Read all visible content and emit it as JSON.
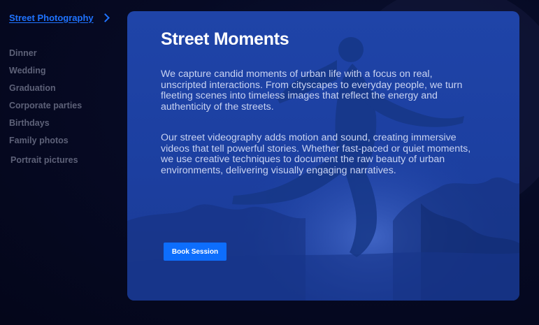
{
  "sidebar": {
    "active_label": "Street Photography",
    "items": [
      {
        "label": "Dinner"
      },
      {
        "label": "Wedding"
      },
      {
        "label": "Graduation"
      },
      {
        "label": "Corporate parties"
      },
      {
        "label": "Birthdays"
      },
      {
        "label": "Family photos"
      },
      {
        "label": "Portrait pictures"
      }
    ]
  },
  "card": {
    "title": "Street Moments",
    "paragraph1": "We capture candid moments of urban life with a focus on real, unscripted interactions. From cityscapes to everyday people, we turn fleeting scenes into timeless images that reflect the energy and authenticity of the streets.",
    "paragraph2": "Our street videography adds motion and sound, creating immersive videos that tell powerful stories. Whether fast-paced or quiet moments, we use creative techniques to document the raw beauty of urban environments, delivering visually engaging narratives.",
    "button_label": "Book Session"
  },
  "colors": {
    "accent": "#1f73ff",
    "button": "#0d6efd",
    "card_overlay": "#1f44a8",
    "background": "#050820"
  },
  "icons": {
    "active_item_chevron": "chevron-right-icon"
  }
}
